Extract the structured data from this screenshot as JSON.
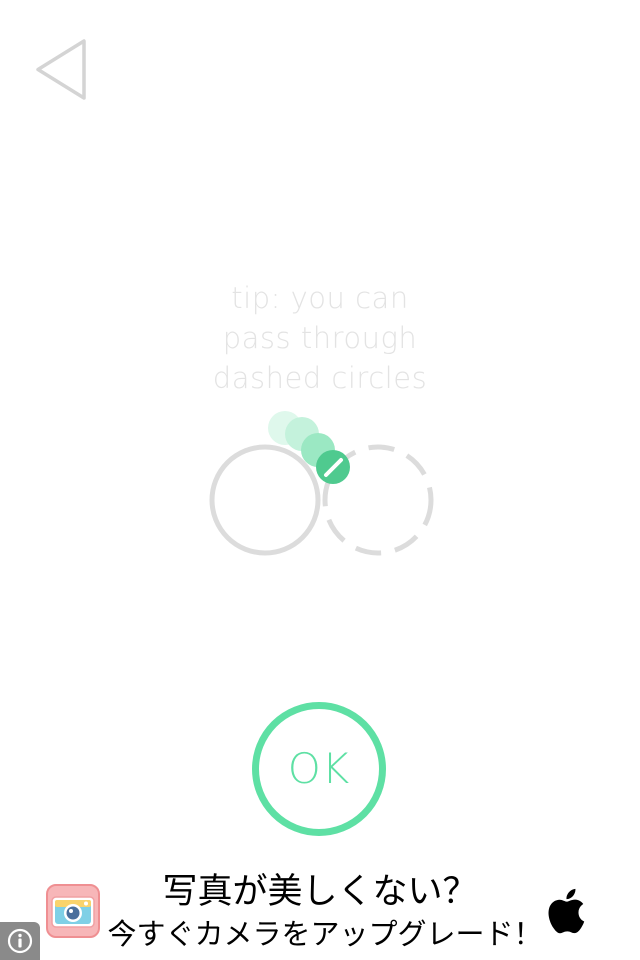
{
  "navigation": {
    "back_icon": "back-triangle-icon"
  },
  "tip": {
    "lines": [
      "tip: you can",
      "pass through",
      "dashed circles"
    ]
  },
  "illustration": {
    "solid_circle_icon": "solid-circle",
    "dashed_circle_icon": "dashed-circle",
    "ball_trail_icon": "ball-trail"
  },
  "ok_button": {
    "label": "OK"
  },
  "ad": {
    "line1": "写真が美しくない？",
    "line2": "今すぐカメラをアップグレード！",
    "app_icon": "camera-app-icon",
    "store_icon": "apple-icon",
    "info_icon": "info-icon"
  },
  "colors": {
    "background": "#ffffff",
    "accent": "#5ee0a4",
    "tip_text": "#e3e3e3",
    "circle_stroke": "#dcdcdc",
    "ball_dark": "#4fca8f",
    "ball_light": "#b7f0d4"
  }
}
